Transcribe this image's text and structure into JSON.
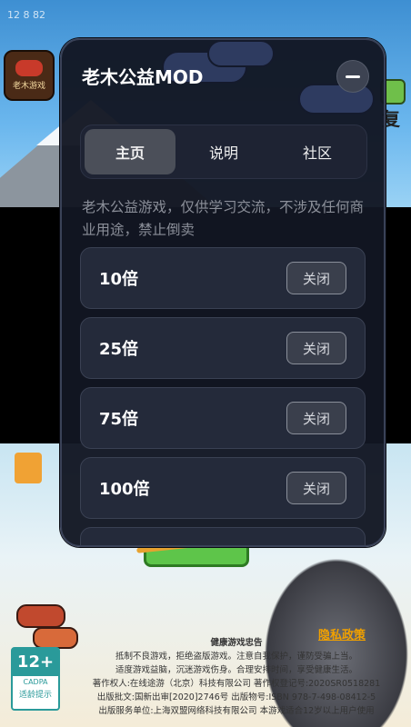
{
  "statusbar": {
    "time": "12 8 82"
  },
  "app_icon": {
    "label": "老木游戏"
  },
  "right_fragment": {
    "text": "复"
  },
  "menu": {
    "title": "老木公益MOD",
    "tabs": [
      {
        "label": "主页",
        "active": true
      },
      {
        "label": "说明",
        "active": false
      },
      {
        "label": "社区",
        "active": false
      }
    ],
    "description": "老木公益游戏，仅供学习交流，不涉及任何商业用途，禁止倒卖",
    "options": [
      {
        "label": "10倍",
        "button": "关闭"
      },
      {
        "label": "25倍",
        "button": "关闭"
      },
      {
        "label": "75倍",
        "button": "关闭"
      },
      {
        "label": "100倍",
        "button": "关闭"
      }
    ]
  },
  "footer": {
    "privacy_link": "隐私政策",
    "age_rating": {
      "number": "12+",
      "org": "CADPA",
      "tip": "适龄提示"
    },
    "notice_title": "健康游戏忠告",
    "notice_lines": [
      "抵制不良游戏，拒绝盗版游戏。注意自我保护，谨防受骗上当。",
      "适度游戏益脑，沉迷游戏伤身。合理安排时间，享受健康生活。",
      "著作权人:在线途游（北京）科技有限公司 著作权登记号:2020SR0518281",
      "出版批文:国新出审[2020]2746号 出版物号:ISBN 978-7-498-08412-5",
      "出版服务单位:上海双盟网络科技有限公司 本游戏适合12岁以上用户使用"
    ]
  },
  "colors": {
    "panel_bg": "#12162a",
    "accent_tab": "#4b4f59",
    "privacy": "#f0a000"
  }
}
